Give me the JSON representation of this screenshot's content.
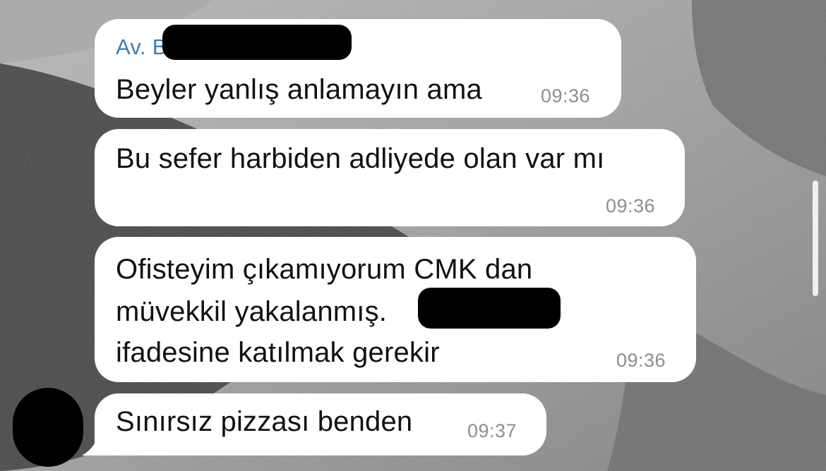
{
  "chat": {
    "messages": [
      {
        "sender": "Av. B",
        "text": "Beyler yanlış anlamayın ama",
        "time": "09:36"
      },
      {
        "text": "Bu sefer harbiden adliyede olan var mı",
        "time": "09:36"
      },
      {
        "lines": [
          "Ofisteyim çıkamıyorum CMK dan",
          "müvekkil yakalanmış.",
          "ifadesine katılmak gerekir"
        ],
        "time": "09:36"
      },
      {
        "text": "Sınırsız pizzası benden",
        "time": "09:37"
      }
    ]
  },
  "colors": {
    "bubble": "#ffffff",
    "sender": "#3a7fb4",
    "text": "#111111",
    "time": "#8e8e93",
    "redaction": "#000000"
  },
  "icons": {
    "avatar": "avatar-redacted"
  }
}
